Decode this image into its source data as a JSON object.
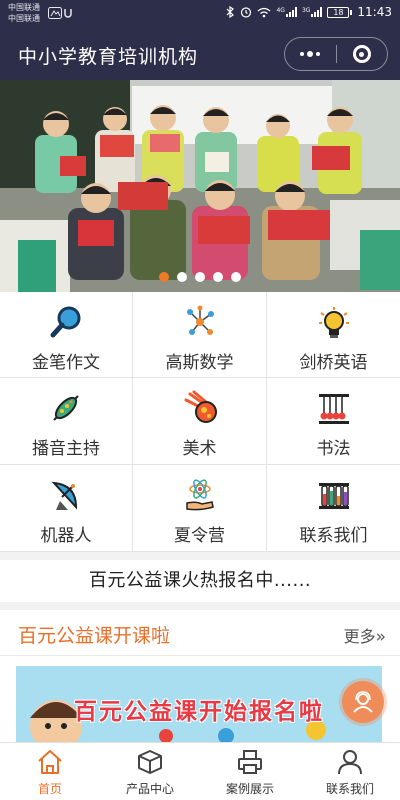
{
  "status_bar": {
    "carrier_1": "中国联通",
    "carrier_2": "中国联通",
    "signal_1_label": "4G",
    "signal_2_label": "3G",
    "battery": "18",
    "time": "11:43"
  },
  "nav": {
    "title": "中小学教育培训机构"
  },
  "banner": {
    "slide_count": 5,
    "active_slide": 1
  },
  "categories": [
    {
      "label": "金笔作文",
      "icon": "magnifier-icon"
    },
    {
      "label": "高斯数学",
      "icon": "molecule-icon"
    },
    {
      "label": "剑桥英语",
      "icon": "lightbulb-icon"
    },
    {
      "label": "播音主持",
      "icon": "microbe-icon"
    },
    {
      "label": "美术",
      "icon": "comet-icon"
    },
    {
      "label": "书法",
      "icon": "newton-cradle-icon"
    },
    {
      "label": "机器人",
      "icon": "satellite-dish-icon"
    },
    {
      "label": "夏令营",
      "icon": "atom-hand-icon"
    },
    {
      "label": "联系我们",
      "icon": "test-tubes-icon"
    }
  ],
  "ticker": "百元公益课火热报名中......",
  "section": {
    "title": "百元公益课开课啦",
    "more": "更多"
  },
  "promo": {
    "text": "百元公益课开始报名啦"
  },
  "tabbar": [
    {
      "label": "首页",
      "icon": "home-icon"
    },
    {
      "label": "产品中心",
      "icon": "cube-icon"
    },
    {
      "label": "案例展示",
      "icon": "printer-icon"
    },
    {
      "label": "联系我们",
      "icon": "user-icon"
    }
  ],
  "colors": {
    "header_bg": "#2d2e4a",
    "accent": "#e8702a",
    "fab": "#f08c5a"
  }
}
